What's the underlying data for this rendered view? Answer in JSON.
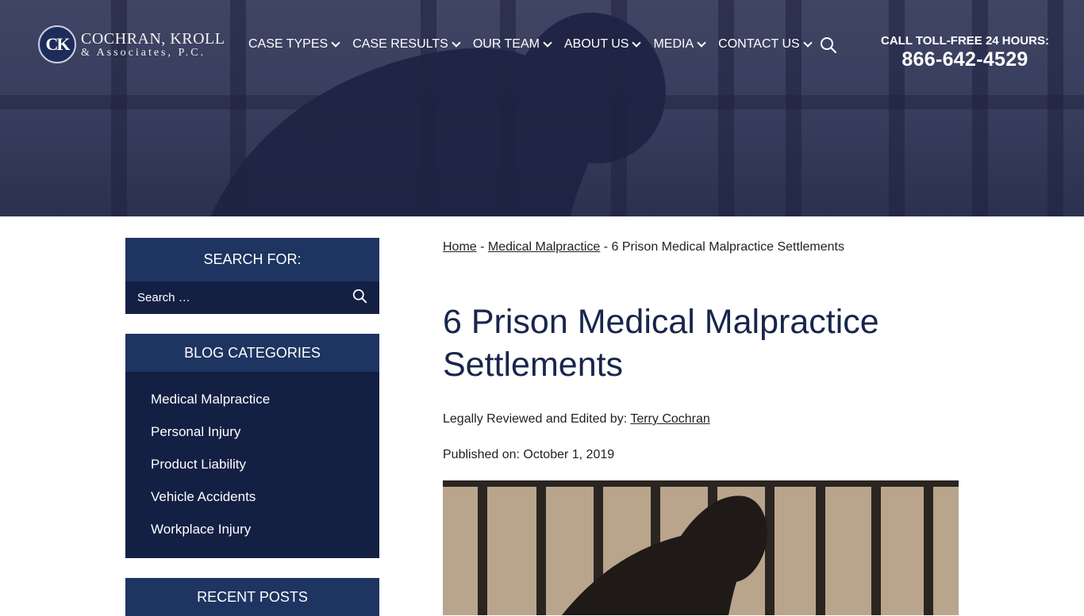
{
  "header": {
    "logo_mark": "CK",
    "logo_line1": "COCHRAN, KROLL",
    "logo_line2": "& Associates, P.C.",
    "nav": [
      {
        "label": "CASE TYPES"
      },
      {
        "label": "CASE RESULTS"
      },
      {
        "label": "OUR TEAM"
      },
      {
        "label": "ABOUT US"
      },
      {
        "label": "MEDIA"
      },
      {
        "label": "CONTACT US"
      }
    ],
    "call_label": "CALL TOLL-FREE 24 HOURS:",
    "phone": "866-642-4529"
  },
  "sidebar": {
    "search_title": "SEARCH FOR:",
    "search_placeholder": "Search …",
    "categories_title": "BLOG CATEGORIES",
    "categories": [
      {
        "label": "Medical Malpractice"
      },
      {
        "label": "Personal Injury"
      },
      {
        "label": "Product Liability"
      },
      {
        "label": "Vehicle Accidents"
      },
      {
        "label": "Workplace Injury"
      }
    ],
    "recent_title": "RECENT POSTS"
  },
  "main": {
    "breadcrumb": {
      "home": "Home",
      "sep": " - ",
      "category": "Medical Malpractice",
      "current": "6 Prison Medical Malpractice Settlements"
    },
    "title": "6 Prison Medical Malpractice Settlements",
    "reviewed_label": "Legally Reviewed and Edited by: ",
    "reviewer": "Terry Cochran",
    "published": "Published on: October 1, 2019"
  },
  "colors": {
    "navy": "#1e3461",
    "dark_navy": "#141f44",
    "title": "#17264a"
  }
}
